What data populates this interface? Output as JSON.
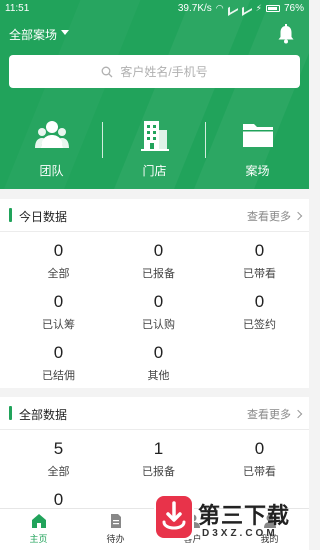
{
  "status_bar": {
    "time": "11:51",
    "speed": "39.7K/s",
    "battery": "76%"
  },
  "header": {
    "project_selector": "全部案场",
    "search_placeholder": "客户姓名/手机号",
    "nav": [
      {
        "label": "团队",
        "icon": "team-icon"
      },
      {
        "label": "门店",
        "icon": "store-icon"
      },
      {
        "label": "案场",
        "icon": "folder-icon"
      }
    ]
  },
  "today": {
    "title": "今日数据",
    "more": "查看更多",
    "stats": [
      {
        "value": "0",
        "label": "全部"
      },
      {
        "value": "0",
        "label": "已报备"
      },
      {
        "value": "0",
        "label": "已带看"
      },
      {
        "value": "0",
        "label": "已认筹"
      },
      {
        "value": "0",
        "label": "已认购"
      },
      {
        "value": "0",
        "label": "已签约"
      },
      {
        "value": "0",
        "label": "已结佣"
      },
      {
        "value": "0",
        "label": "其他"
      }
    ]
  },
  "all": {
    "title": "全部数据",
    "more": "查看更多",
    "stats": [
      {
        "value": "5",
        "label": "全部"
      },
      {
        "value": "1",
        "label": "已报备"
      },
      {
        "value": "0",
        "label": "已带看"
      },
      {
        "value": "0",
        "label": ""
      }
    ]
  },
  "tabbar": [
    {
      "label": "主页",
      "icon": "home-icon",
      "active": true
    },
    {
      "label": "待办",
      "icon": "todo-icon",
      "active": false
    },
    {
      "label": "客户",
      "icon": "customer-icon",
      "active": false
    },
    {
      "label": "我的",
      "icon": "profile-icon",
      "active": false
    }
  ],
  "watermark": {
    "name": "第三下载",
    "domain": "D3XZ.COM"
  },
  "colors": {
    "primary": "#21a35b",
    "background": "#f3f3f3",
    "text": "#222222"
  }
}
